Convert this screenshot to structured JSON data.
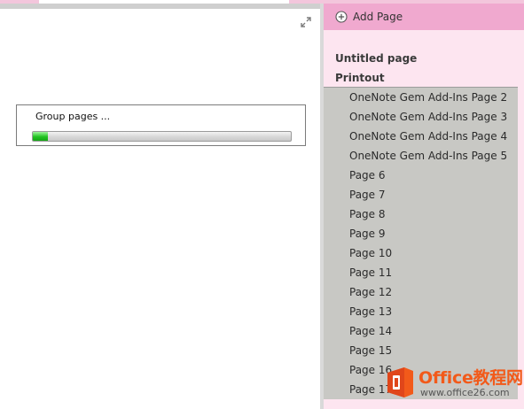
{
  "progress": {
    "label": "Group pages ...",
    "percent": 6
  },
  "panel": {
    "add_page_label": "Add Page",
    "pages": [
      {
        "label": "Untitled page",
        "level": 1,
        "selected": false
      },
      {
        "label": "Printout",
        "level": 1,
        "selected": false
      },
      {
        "label": "OneNote Gem Add-Ins Page 2",
        "level": 2,
        "selected": true
      },
      {
        "label": "OneNote Gem Add-Ins Page 3",
        "level": 2,
        "selected": true
      },
      {
        "label": "OneNote Gem Add-Ins Page 4",
        "level": 2,
        "selected": true
      },
      {
        "label": "OneNote Gem Add-Ins Page 5",
        "level": 2,
        "selected": true
      },
      {
        "label": "Page 6",
        "level": 2,
        "selected": true
      },
      {
        "label": "Page 7",
        "level": 2,
        "selected": true
      },
      {
        "label": "Page 8",
        "level": 2,
        "selected": true
      },
      {
        "label": "Page 9",
        "level": 2,
        "selected": true
      },
      {
        "label": "Page 10",
        "level": 2,
        "selected": true
      },
      {
        "label": "Page 11",
        "level": 2,
        "selected": true
      },
      {
        "label": "Page 12",
        "level": 2,
        "selected": true
      },
      {
        "label": "Page 13",
        "level": 2,
        "selected": true
      },
      {
        "label": "Page 14",
        "level": 2,
        "selected": true
      },
      {
        "label": "Page 15",
        "level": 2,
        "selected": true
      },
      {
        "label": "Page 16",
        "level": 2,
        "selected": true
      },
      {
        "label": "Page 17",
        "level": 2,
        "selected": true
      }
    ]
  },
  "watermark": {
    "brand": "Office教程网",
    "url": "www.office26.com"
  },
  "colors": {
    "tab_pink": "#f0a9cf",
    "panel_pink": "#fde5f0",
    "selection_gray": "#c8c8c4",
    "progress_green": "#22c322",
    "brand_orange": "#f25a1a"
  },
  "icons": {
    "expand": "expand-diagonal-icon",
    "add_page": "plus-circle-icon",
    "logo": "office-logo-icon"
  }
}
